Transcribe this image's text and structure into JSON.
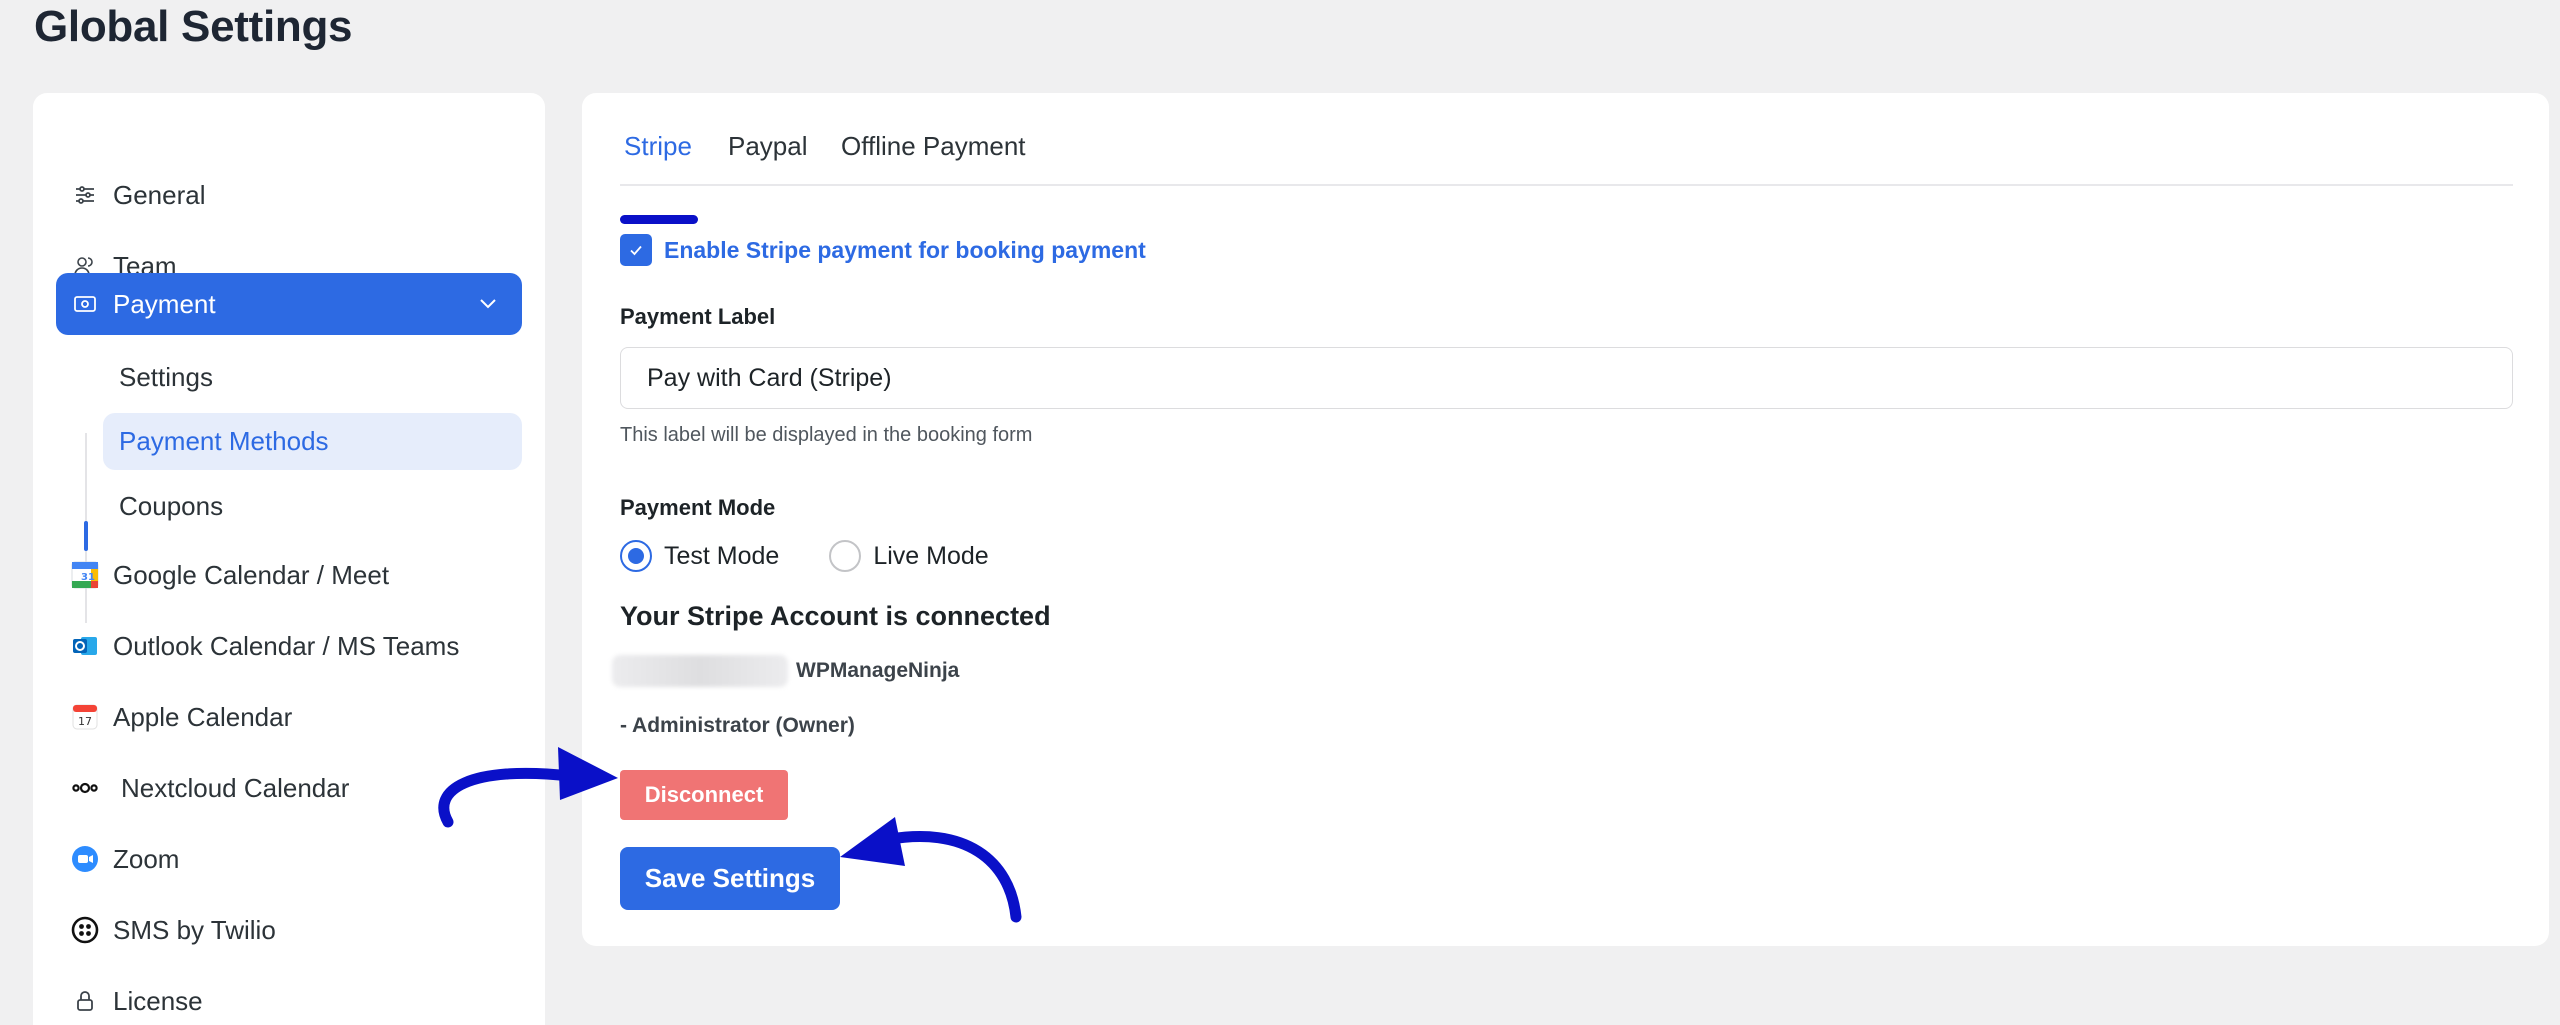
{
  "page": {
    "title": "Global Settings"
  },
  "sidebar": {
    "items": [
      {
        "label": "General",
        "icon": "sliders-icon"
      },
      {
        "label": "Team",
        "icon": "team-icon"
      },
      {
        "label": "Payment",
        "icon": "payment-icon",
        "active": true
      },
      {
        "label": "Google Calendar / Meet",
        "icon": "google-calendar-icon"
      },
      {
        "label": "Outlook Calendar / MS Teams",
        "icon": "outlook-icon"
      },
      {
        "label": "Apple Calendar",
        "icon": "apple-calendar-icon"
      },
      {
        "label": "Nextcloud Calendar",
        "icon": "nextcloud-icon"
      },
      {
        "label": "Zoom",
        "icon": "zoom-icon"
      },
      {
        "label": "SMS by Twilio",
        "icon": "twilio-icon"
      },
      {
        "label": "License",
        "icon": "lock-icon"
      }
    ],
    "payment_subitems": [
      {
        "label": "Settings"
      },
      {
        "label": "Payment Methods",
        "active": true
      },
      {
        "label": "Coupons"
      }
    ]
  },
  "main": {
    "tabs": [
      {
        "label": "Stripe",
        "active": true
      },
      {
        "label": "Paypal"
      },
      {
        "label": "Offline Payment"
      }
    ],
    "enable_checkbox": {
      "label": "Enable Stripe payment for booking payment",
      "checked": true
    },
    "payment_label": {
      "label": "Payment Label",
      "value": "Pay with Card (Stripe)",
      "help": "This label will be displayed in the booking form"
    },
    "payment_mode": {
      "label": "Payment Mode",
      "options": [
        {
          "label": "Test Mode",
          "checked": true
        },
        {
          "label": "Live Mode",
          "checked": false
        }
      ]
    },
    "account": {
      "title": "Your Stripe Account is connected",
      "name": "WPManageNinja",
      "role": "- Administrator (Owner)"
    },
    "disconnect_label": "Disconnect",
    "save_label": "Save Settings"
  },
  "colors": {
    "accent": "#2d6ae3",
    "danger": "#f07474",
    "annotation_arrow": "#0a10c8"
  }
}
